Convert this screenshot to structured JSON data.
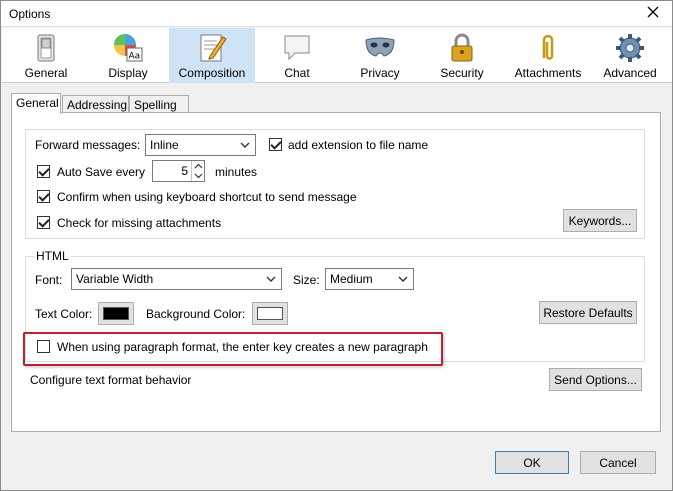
{
  "window": {
    "title": "Options"
  },
  "toolbar": {
    "items": [
      {
        "label": "General",
        "icon": "switch-icon"
      },
      {
        "label": "Display",
        "icon": "palette-icon"
      },
      {
        "label": "Composition",
        "icon": "compose-icon",
        "active": true
      },
      {
        "label": "Chat",
        "icon": "chat-bubble-icon"
      },
      {
        "label": "Privacy",
        "icon": "mask-icon"
      },
      {
        "label": "Security",
        "icon": "padlock-icon"
      },
      {
        "label": "Attachments",
        "icon": "paperclip-icon"
      },
      {
        "label": "Advanced",
        "icon": "gear-icon"
      }
    ]
  },
  "subtabs": [
    "General",
    "Addressing",
    "Spelling"
  ],
  "general": {
    "forward_label": "Forward messages:",
    "forward_value": "Inline",
    "add_extension_label": "add extension to file name",
    "autosave_label": "Auto Save every",
    "autosave_value": "5",
    "autosave_unit": "minutes",
    "confirm_shortcut_label": "Confirm when using keyboard shortcut to send message",
    "check_missing_label": "Check for missing attachments",
    "keywords_button": "Keywords..."
  },
  "html": {
    "group_label": "HTML",
    "font_label": "Font:",
    "font_value": "Variable Width",
    "size_label": "Size:",
    "size_value": "Medium",
    "text_color_label": "Text Color:",
    "text_color": "#000000",
    "background_color_label": "Background Color:",
    "background_color": "#ffffff",
    "restore_button": "Restore Defaults",
    "paragraph_label": "When using paragraph format, the enter key creates a new paragraph"
  },
  "send": {
    "configure_label": "Configure text format behavior",
    "send_options_button": "Send Options..."
  },
  "footer": {
    "ok": "OK",
    "cancel": "Cancel"
  },
  "accent_colors": {
    "active_tab": "#cfe3f7",
    "highlight_box": "#b8232f"
  }
}
